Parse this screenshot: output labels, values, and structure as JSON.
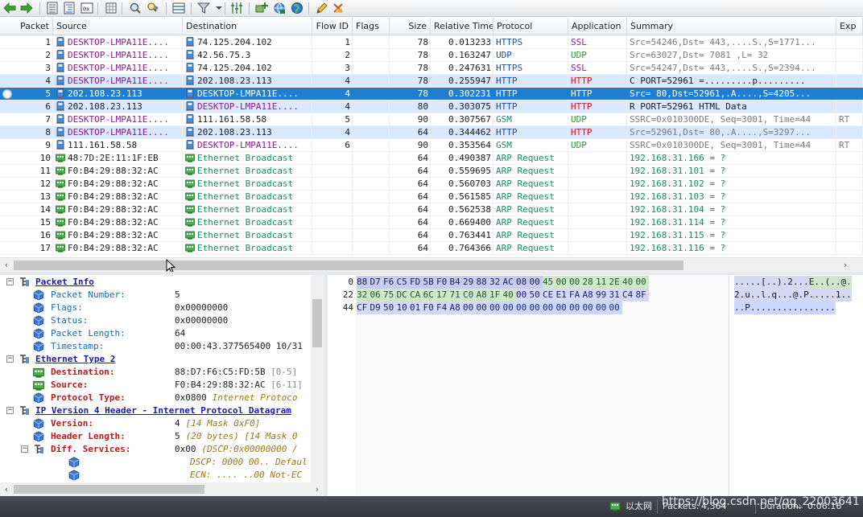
{
  "toolbar": {
    "icons": [
      "back-arrow-icon",
      "forward-arrow-icon",
      "packet-list-icon",
      "packet-detail-icon",
      "hex-view-icon",
      "grid-icon",
      "find-icon",
      "find-next-icon",
      "layout-icon",
      "filter-icon",
      "filter-dropdown-icon",
      "columns-icon",
      "add-node-icon",
      "network-icon",
      "globe-icon",
      "edit-icon",
      "clear-icon"
    ]
  },
  "columns": [
    "Packet",
    "Source",
    "Destination",
    "Flow ID",
    "Flags",
    "Size",
    "Relative Time",
    "Protocol",
    "Application",
    "Summary",
    "Exp"
  ],
  "packets": [
    {
      "n": "1",
      "src": "DESKTOP-LMPA11E....",
      "src_type": "pc",
      "dst": "74.125.204.102",
      "dst_type": "pc",
      "flow": "1",
      "size": "78",
      "time": "0.013233",
      "proto": "HTTPS",
      "app": "SSL",
      "summary": "Src=54246,Dst=  443,....S.,S=1771...",
      "exp": "",
      "style": "normal",
      "src_color": "purple",
      "dst_color": "dark",
      "proto_color": "blue",
      "app_color": "ssl",
      "summary_color": "grey"
    },
    {
      "n": "2",
      "src": "DESKTOP-LMPA11E....",
      "src_type": "pc",
      "dst": "42.56.75.3",
      "dst_type": "pc",
      "flow": "2",
      "size": "78",
      "time": "0.163247",
      "proto": "UDP",
      "app": "UDP",
      "summary": "Src=63027,Dst= 7081 ,L=   32",
      "exp": "",
      "style": "normal",
      "src_color": "purple",
      "dst_color": "dark",
      "proto_color": "blue",
      "app_color": "udp",
      "summary_color": "grey"
    },
    {
      "n": "3",
      "src": "DESKTOP-LMPA11E....",
      "src_type": "pc",
      "dst": "74.125.204.102",
      "dst_type": "pc",
      "flow": "3",
      "size": "78",
      "time": "0.247631",
      "proto": "HTTPS",
      "app": "SSL",
      "summary": "Src=54247,Dst=  443,....S.,S=2394...",
      "exp": "",
      "style": "normal",
      "src_color": "purple",
      "dst_color": "dark",
      "proto_color": "blue",
      "app_color": "ssl",
      "summary_color": "grey"
    },
    {
      "n": "4",
      "src": "DESKTOP-LMPA11E....",
      "src_type": "pc",
      "dst": "202.108.23.113",
      "dst_type": "pc",
      "flow": "4",
      "size": "78",
      "time": "0.255947",
      "proto": "HTTP",
      "app": "HTTP",
      "summary": "C PORT=52961 =.........p.........",
      "exp": "",
      "style": "hl",
      "src_color": "purple",
      "dst_color": "dark",
      "proto_color": "blue",
      "app_color": "http",
      "summary_color": "dark"
    },
    {
      "n": "5",
      "src": "202.108.23.113",
      "src_type": "pc",
      "dst": "DESKTOP-LMPA11E....",
      "dst_type": "pc",
      "flow": "4",
      "size": "78",
      "time": "0.302231",
      "proto": "HTTP",
      "app": "HTTP",
      "summary": "Src=   80,Dst=52961,.A....,S=4205...",
      "exp": "",
      "style": "sel",
      "src_color": "dark",
      "dst_color": "purple",
      "proto_color": "blue",
      "app_color": "http",
      "summary_color": "dark"
    },
    {
      "n": "6",
      "src": "202.108.23.113",
      "src_type": "pc",
      "dst": "DESKTOP-LMPA11E....",
      "dst_type": "pc",
      "flow": "4",
      "size": "80",
      "time": "0.303075",
      "proto": "HTTP",
      "app": "HTTP",
      "summary": "R PORT=52961 HTML Data",
      "exp": "",
      "style": "hl",
      "src_color": "dark",
      "dst_color": "purple",
      "proto_color": "blue",
      "app_color": "http",
      "summary_color": "dark"
    },
    {
      "n": "7",
      "src": "DESKTOP-LMPA11E....",
      "src_type": "pc",
      "dst": "111.161.58.58",
      "dst_type": "pc",
      "flow": "5",
      "size": "90",
      "time": "0.307567",
      "proto": "GSM",
      "app": "UDP",
      "summary": "SSRC=0x010300DE, Seq=3001, Time=44",
      "exp": "RT",
      "style": "normal",
      "src_color": "purple",
      "dst_color": "dark",
      "proto_color": "green",
      "app_color": "udp",
      "summary_color": "grey"
    },
    {
      "n": "8",
      "src": "DESKTOP-LMPA11E....",
      "src_type": "pc",
      "dst": "202.108.23.113",
      "dst_type": "pc",
      "flow": "4",
      "size": "64",
      "time": "0.344462",
      "proto": "HTTP",
      "app": "HTTP",
      "summary": "Src=52961,Dst=   80,.A....,S=3297...",
      "exp": "",
      "style": "hl",
      "src_color": "purple",
      "dst_color": "dark",
      "proto_color": "blue",
      "app_color": "http",
      "summary_color": "grey"
    },
    {
      "n": "9",
      "src": "111.161.58.58",
      "src_type": "pc",
      "dst": "DESKTOP-LMPA11E....",
      "dst_type": "pc",
      "flow": "6",
      "size": "90",
      "time": "0.353564",
      "proto": "GSM",
      "app": "UDP",
      "summary": "SSRC=0x010300DE, Seq=3001, Time=44",
      "exp": "RT",
      "style": "normal",
      "src_color": "dark",
      "dst_color": "purple",
      "proto_color": "green",
      "app_color": "udp",
      "summary_color": "grey"
    },
    {
      "n": "10",
      "src": "48:7D:2E:11:1F:EB",
      "src_type": "nic",
      "dst": "Ethernet Broadcast",
      "dst_type": "nic",
      "flow": "",
      "size": "64",
      "time": "0.490387",
      "proto": "ARP Request",
      "app": "",
      "summary": "192.168.31.166 = ?",
      "exp": "",
      "style": "normal",
      "src_color": "dark",
      "dst_color": "green",
      "proto_color": "green",
      "app_color": "udp",
      "summary_color": "green"
    },
    {
      "n": "11",
      "src": "F0:B4:29:88:32:AC",
      "src_type": "nic",
      "dst": "Ethernet Broadcast",
      "dst_type": "nic",
      "flow": "",
      "size": "64",
      "time": "0.559695",
      "proto": "ARP Request",
      "app": "",
      "summary": "192.168.31.101 = ?",
      "exp": "",
      "style": "normal",
      "src_color": "dark",
      "dst_color": "green",
      "proto_color": "green",
      "app_color": "udp",
      "summary_color": "green"
    },
    {
      "n": "12",
      "src": "F0:B4:29:88:32:AC",
      "src_type": "nic",
      "dst": "Ethernet Broadcast",
      "dst_type": "nic",
      "flow": "",
      "size": "64",
      "time": "0.560703",
      "proto": "ARP Request",
      "app": "",
      "summary": "192.168.31.102 = ?",
      "exp": "",
      "style": "normal",
      "src_color": "dark",
      "dst_color": "green",
      "proto_color": "green",
      "app_color": "udp",
      "summary_color": "green"
    },
    {
      "n": "13",
      "src": "F0:B4:29:88:32:AC",
      "src_type": "nic",
      "dst": "Ethernet Broadcast",
      "dst_type": "nic",
      "flow": "",
      "size": "64",
      "time": "0.561585",
      "proto": "ARP Request",
      "app": "",
      "summary": "192.168.31.103 = ?",
      "exp": "",
      "style": "normal",
      "src_color": "dark",
      "dst_color": "green",
      "proto_color": "green",
      "app_color": "udp",
      "summary_color": "green"
    },
    {
      "n": "14",
      "src": "F0:B4:29:88:32:AC",
      "src_type": "nic",
      "dst": "Ethernet Broadcast",
      "dst_type": "nic",
      "flow": "",
      "size": "64",
      "time": "0.562538",
      "proto": "ARP Request",
      "app": "",
      "summary": "192.168.31.104 = ?",
      "exp": "",
      "style": "normal",
      "src_color": "dark",
      "dst_color": "green",
      "proto_color": "green",
      "app_color": "udp",
      "summary_color": "green"
    },
    {
      "n": "15",
      "src": "F0:B4:29:88:32:AC",
      "src_type": "nic",
      "dst": "Ethernet Broadcast",
      "dst_type": "nic",
      "flow": "",
      "size": "64",
      "time": "0.669400",
      "proto": "ARP Request",
      "app": "",
      "summary": "192.168.31.114 = ?",
      "exp": "",
      "style": "normal",
      "src_color": "dark",
      "dst_color": "green",
      "proto_color": "green",
      "app_color": "udp",
      "summary_color": "green"
    },
    {
      "n": "16",
      "src": "F0:B4:29:88:32:AC",
      "src_type": "nic",
      "dst": "Ethernet Broadcast",
      "dst_type": "nic",
      "flow": "",
      "size": "64",
      "time": "0.763441",
      "proto": "ARP Request",
      "app": "",
      "summary": "192.168.31.115 = ?",
      "exp": "",
      "style": "normal",
      "src_color": "dark",
      "dst_color": "green",
      "proto_color": "green",
      "app_color": "udp",
      "summary_color": "green"
    },
    {
      "n": "17",
      "src": "F0:B4:29:88:32:AC",
      "src_type": "nic",
      "dst": "Ethernet Broadcast",
      "dst_type": "nic",
      "flow": "",
      "size": "64",
      "time": "0.764366",
      "proto": "ARP Request",
      "app": "",
      "summary": "192.168.31.116 = ?",
      "exp": "",
      "style": "normal",
      "src_color": "dark",
      "dst_color": "green",
      "proto_color": "green",
      "app_color": "udp",
      "summary_color": "green"
    }
  ],
  "tree": [
    {
      "level": 0,
      "toggle": "-",
      "icon": "tree-node-icon",
      "label": "Packet Info",
      "kind": "title",
      "value": "",
      "extra": ""
    },
    {
      "level": 1,
      "toggle": "",
      "icon": "cube-icon",
      "label": "Packet Number:",
      "kind": "field",
      "value": "5",
      "extra": ""
    },
    {
      "level": 1,
      "toggle": "",
      "icon": "cube-icon",
      "label": "Flags:",
      "kind": "field",
      "value": "0x00000000",
      "extra": ""
    },
    {
      "level": 1,
      "toggle": "",
      "icon": "cube-icon",
      "label": "Status:",
      "kind": "field",
      "value": "0x00000000",
      "extra": ""
    },
    {
      "level": 1,
      "toggle": "",
      "icon": "cube-icon",
      "label": "Packet Length:",
      "kind": "field",
      "value": "64",
      "extra": ""
    },
    {
      "level": 1,
      "toggle": "",
      "icon": "cube-icon",
      "label": "Timestamp:",
      "kind": "field",
      "value": "00:00:43.377565400 10/31",
      "extra": ""
    },
    {
      "level": 0,
      "toggle": "-",
      "icon": "tree-node-icon",
      "label": "Ethernet Type 2",
      "kind": "title",
      "value": "",
      "extra": ""
    },
    {
      "level": 1,
      "toggle": "",
      "icon": "nic-icon",
      "label": "Destination:",
      "kind": "red",
      "value": "88:D7:F6:C5:FD:5B",
      "extra": "[0-5]"
    },
    {
      "level": 1,
      "toggle": "",
      "icon": "nic-icon",
      "label": "Source:",
      "kind": "red",
      "value": "F0:B4:29:88:32:AC",
      "extra": "[6-11]"
    },
    {
      "level": 1,
      "toggle": "",
      "icon": "cube-icon",
      "label": "Protocol Type:",
      "kind": "red",
      "value": "0x0800",
      "extra": "Internet Protoco"
    },
    {
      "level": 0,
      "toggle": "-",
      "icon": "tree-node-icon",
      "label": "IP Version 4 Header - Internet Protocol Datagram",
      "kind": "title",
      "value": "",
      "extra": ""
    },
    {
      "level": 1,
      "toggle": "",
      "icon": "cube-icon",
      "label": "Version:",
      "kind": "red",
      "value": "4",
      "extra": "[14 Mask 0xF0]"
    },
    {
      "level": 1,
      "toggle": "",
      "icon": "cube-icon",
      "label": "Header Length:",
      "kind": "red",
      "value": "5",
      "extra": "(20 bytes) [14 Mask 0"
    },
    {
      "level": 1,
      "toggle": "-",
      "icon": "tree-node-icon",
      "label": "Diff. Services:",
      "kind": "red",
      "value": "0x00",
      "extra": "(DSCP:0x00000000 /"
    },
    {
      "level": 2,
      "toggle": "",
      "icon": "cube-icon",
      "label": "",
      "kind": "sub",
      "value": "",
      "extra": "DSCP: 0000 00.. Defaul"
    },
    {
      "level": 2,
      "toggle": "",
      "icon": "cube-icon",
      "label": "",
      "kind": "sub",
      "value": "",
      "extra": "ECN:  .... ..00 Not-EC"
    }
  ],
  "hex": {
    "offsets": [
      "0",
      "22",
      "44"
    ],
    "rows": [
      [
        [
          "88",
          "e"
        ],
        [
          "D7",
          "e"
        ],
        [
          "F6",
          "e"
        ],
        [
          "C5",
          "e"
        ],
        [
          "FD",
          "e"
        ],
        [
          "5B",
          "e"
        ],
        [
          "F0",
          "e"
        ],
        [
          "B4",
          "e"
        ],
        [
          "29",
          "e"
        ],
        [
          "88",
          "e"
        ],
        [
          "32",
          "e"
        ],
        [
          "AC",
          "e"
        ],
        [
          "08",
          "e"
        ],
        [
          "00",
          "e"
        ],
        [
          "45",
          "i"
        ],
        [
          "00",
          "i"
        ],
        [
          "00",
          "i"
        ],
        [
          "28",
          "i"
        ],
        [
          "11",
          "i"
        ],
        [
          "2E",
          "i"
        ],
        [
          "40",
          "i"
        ],
        [
          "00",
          "i"
        ]
      ],
      [
        [
          "32",
          "i"
        ],
        [
          "06",
          "i"
        ],
        [
          "75",
          "i"
        ],
        [
          "DC",
          "i"
        ],
        [
          "CA",
          "i"
        ],
        [
          "6C",
          "i"
        ],
        [
          "17",
          "i"
        ],
        [
          "71",
          "i"
        ],
        [
          "C0",
          "i"
        ],
        [
          "A8",
          "i"
        ],
        [
          "1F",
          "i"
        ],
        [
          "40",
          "i"
        ],
        [
          "00",
          "t"
        ],
        [
          "50",
          "t"
        ],
        [
          "CE",
          "t"
        ],
        [
          "E1",
          "t"
        ],
        [
          "FA",
          "t"
        ],
        [
          "A8",
          "t"
        ],
        [
          "99",
          "t"
        ],
        [
          "31",
          "t"
        ],
        [
          "C4",
          "t"
        ],
        [
          "8F",
          "t"
        ]
      ],
      [
        [
          "CF",
          "t"
        ],
        [
          "D9",
          "t"
        ],
        [
          "50",
          "t"
        ],
        [
          "10",
          "t"
        ],
        [
          "01",
          "t"
        ],
        [
          "F0",
          "t"
        ],
        [
          "F4",
          "t"
        ],
        [
          "A8",
          "t"
        ],
        [
          "00",
          "t"
        ],
        [
          "00",
          "t"
        ],
        [
          "00",
          "p"
        ],
        [
          "00",
          "p"
        ],
        [
          "00",
          "p"
        ],
        [
          "00",
          "p"
        ],
        [
          "00",
          "p"
        ],
        [
          "00",
          "p"
        ],
        [
          "00",
          "p"
        ],
        [
          "00",
          "p"
        ],
        [
          "00",
          "p"
        ],
        [
          "00",
          "p"
        ]
      ]
    ],
    "ascii": [
      ".....[..).2...E..(..@.",
      "2.u..l.q...@.P.....1..",
      "..P................"
    ]
  },
  "status": {
    "adapter": "以太网",
    "packets_label": "Packets:",
    "packets": "4,364",
    "duration_label": "Duration:",
    "duration": "0:06:16",
    "watermark": "https://blog.csdn.net/qq_22003641"
  }
}
